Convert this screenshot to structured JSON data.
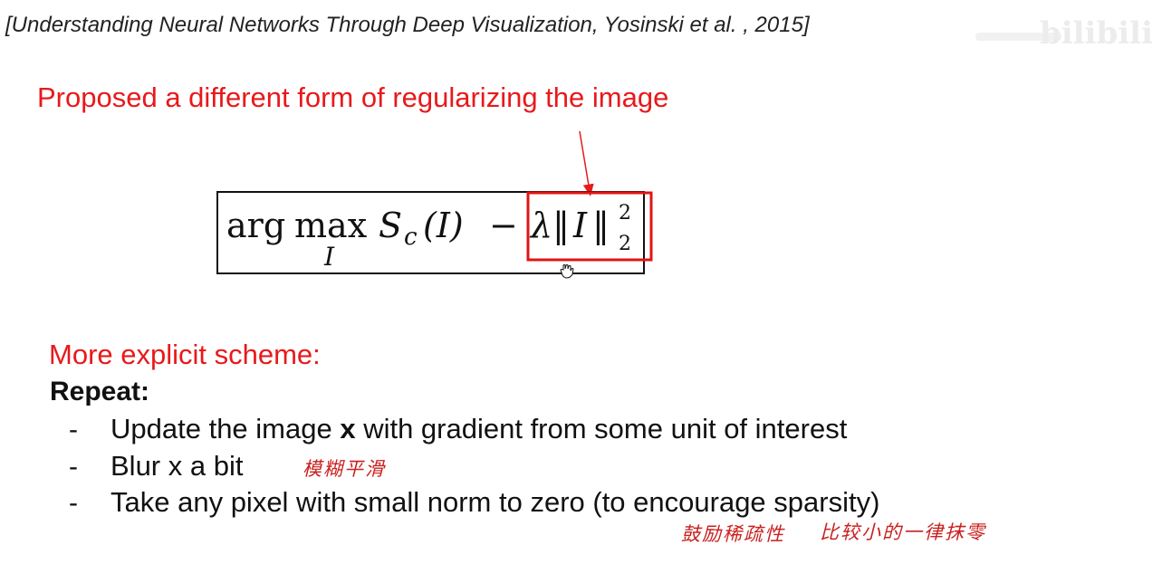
{
  "citation": "[Understanding Neural Networks Through Deep Visualization, Yosinski et al. , 2015]",
  "heading": "Proposed a different form of regularizing the image",
  "formula": {
    "arg": "arg",
    "max": "max",
    "max_sub": "I",
    "score": "S",
    "score_sub": "c",
    "score_arg": "(I)",
    "minus": "−",
    "lambda": "λ",
    "norm_open": "‖",
    "norm_var": "I",
    "norm_close": "‖",
    "sup": "2",
    "sub": "2"
  },
  "scheme_heading": "More explicit scheme:",
  "repeat_label": "Repeat:",
  "steps": [
    {
      "dash": "-",
      "before": "Update the image ",
      "bold": "x",
      "after": " with gradient from some unit of interest"
    },
    {
      "dash": "-",
      "text": "Blur x a bit"
    },
    {
      "dash": "-",
      "text": "Take any pixel with small norm to zero (to encourage sparsity)"
    }
  ],
  "notes": {
    "blur": "模糊平滑",
    "sparsity": "鼓励稀疏性",
    "zero": "比较小的一律抹零"
  },
  "watermark": "bilibili",
  "colors": {
    "accent": "#e8191b",
    "text": "#111111",
    "box": "#111111"
  }
}
